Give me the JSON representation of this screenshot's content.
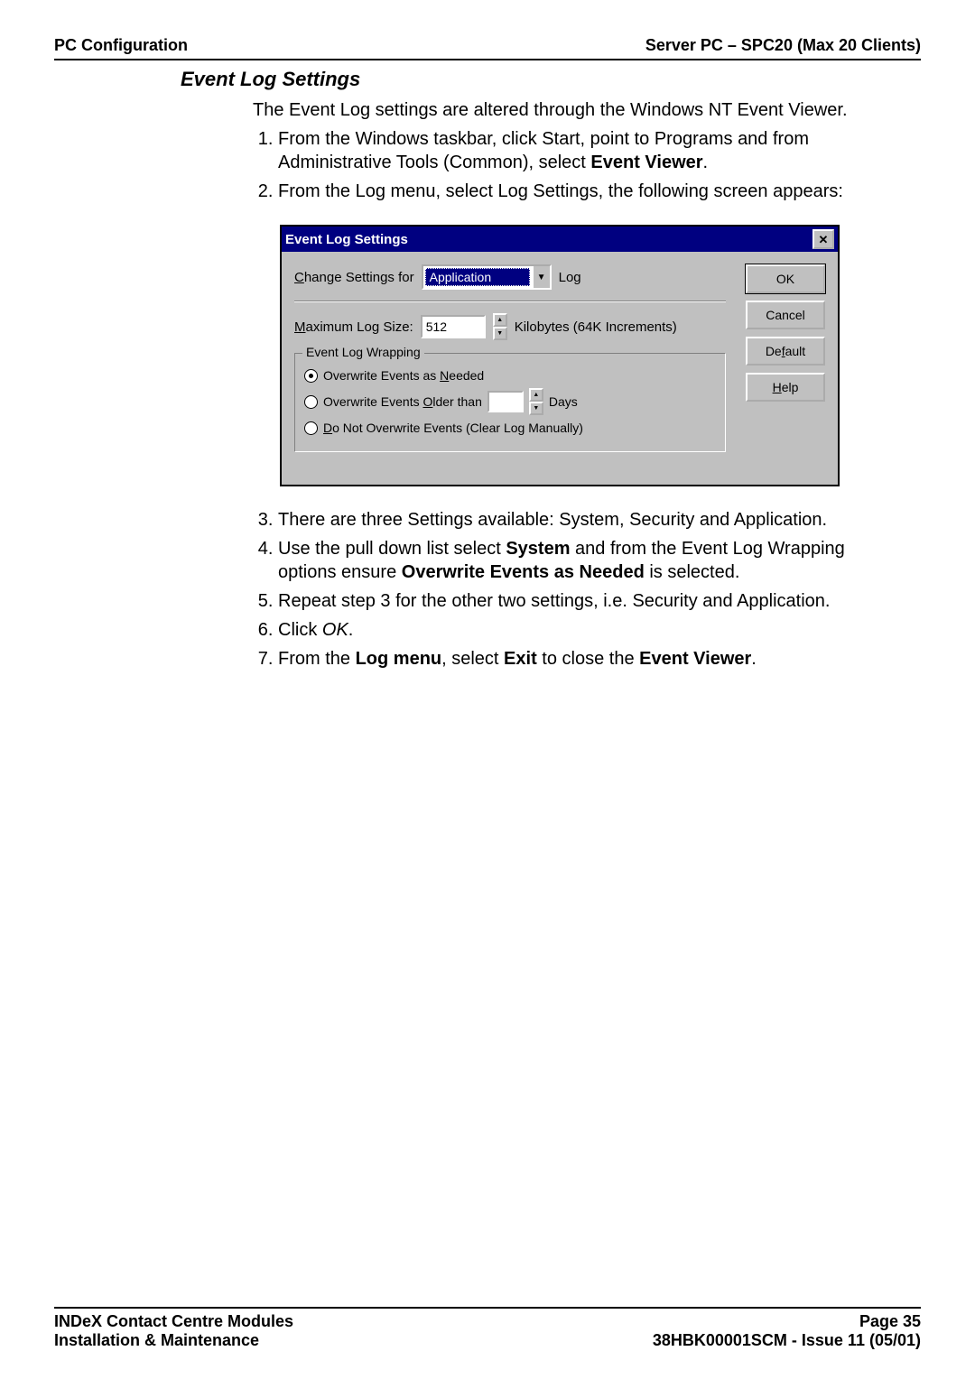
{
  "header": {
    "left": "PC Configuration",
    "right": "Server PC – SPC20 (Max 20 Clients)"
  },
  "title": "Event Log Settings",
  "intro": "The Event Log settings are altered through the Windows NT Event Viewer.",
  "steps1": {
    "s1a": "From the Windows taskbar, click Start, point to Programs and from Administrative Tools (Common), select ",
    "s1b": "Event Viewer",
    "s1c": ".",
    "s2": "From the Log menu, select Log Settings, the following screen appears:"
  },
  "dialog": {
    "title": "Event Log Settings",
    "change_label_pre": "C",
    "change_label": "hange Settings for",
    "combo_value": "Application",
    "log_suffix": "Log",
    "max_pre": "M",
    "max_label": "aximum Log Size:",
    "max_value": "512",
    "kb_label": "Kilobytes  (64K Increments)",
    "group_title": "Event Log Wrapping",
    "r1_pre": "Overwrite Events as ",
    "r1_u": "N",
    "r1_post": "eeded",
    "r2_pre": "Overwrite Events ",
    "r2_u": "O",
    "r2_post": "lder than",
    "r2_days": "Days",
    "r3_u": "D",
    "r3_post": "o Not Overwrite Events (Clear Log Manually)",
    "btn_ok": "OK",
    "btn_cancel": "Cancel",
    "btn_default_pre": "De",
    "btn_default_u": "f",
    "btn_default_post": "ault",
    "btn_help_u": "H",
    "btn_help_post": "elp"
  },
  "steps2": {
    "s3": "There are three Settings available: System, Security and Application.",
    "s4a": "Use the pull down list select ",
    "s4b": "System",
    "s4c": " and from the Event Log Wrapping options ensure ",
    "s4d": "Overwrite Events as Needed",
    "s4e": " is selected.",
    "s5": "Repeat step 3 for the other two settings, i.e. Security and Application.",
    "s6a": "Click ",
    "s6b": "OK",
    "s6c": ".",
    "s7a": "From the ",
    "s7b": "Log menu",
    "s7c": ", select ",
    "s7d": "Exit",
    "s7e": " to close the ",
    "s7f": "Event Viewer",
    "s7g": "."
  },
  "footer": {
    "l1": "INDeX Contact Centre Modules",
    "l2": "Installation & Maintenance",
    "r1": "Page 35",
    "r2": "38HBK00001SCM - Issue 11 (05/01)"
  },
  "chart_data": {
    "type": "table",
    "title": "Event Log Settings (Windows NT dialog)",
    "fields": [
      {
        "label": "Change Settings for",
        "value": "Application",
        "control": "combobox"
      },
      {
        "label": "Maximum Log Size",
        "value": 512,
        "units": "Kilobytes (64K Increments)",
        "control": "spinner"
      }
    ],
    "radio_group": {
      "title": "Event Log Wrapping",
      "options": [
        {
          "label": "Overwrite Events as Needed",
          "selected": true
        },
        {
          "label": "Overwrite Events Older than [ ] Days",
          "selected": false
        },
        {
          "label": "Do Not Overwrite Events (Clear Log Manually)",
          "selected": false
        }
      ]
    },
    "buttons": [
      "OK",
      "Cancel",
      "Default",
      "Help"
    ]
  }
}
